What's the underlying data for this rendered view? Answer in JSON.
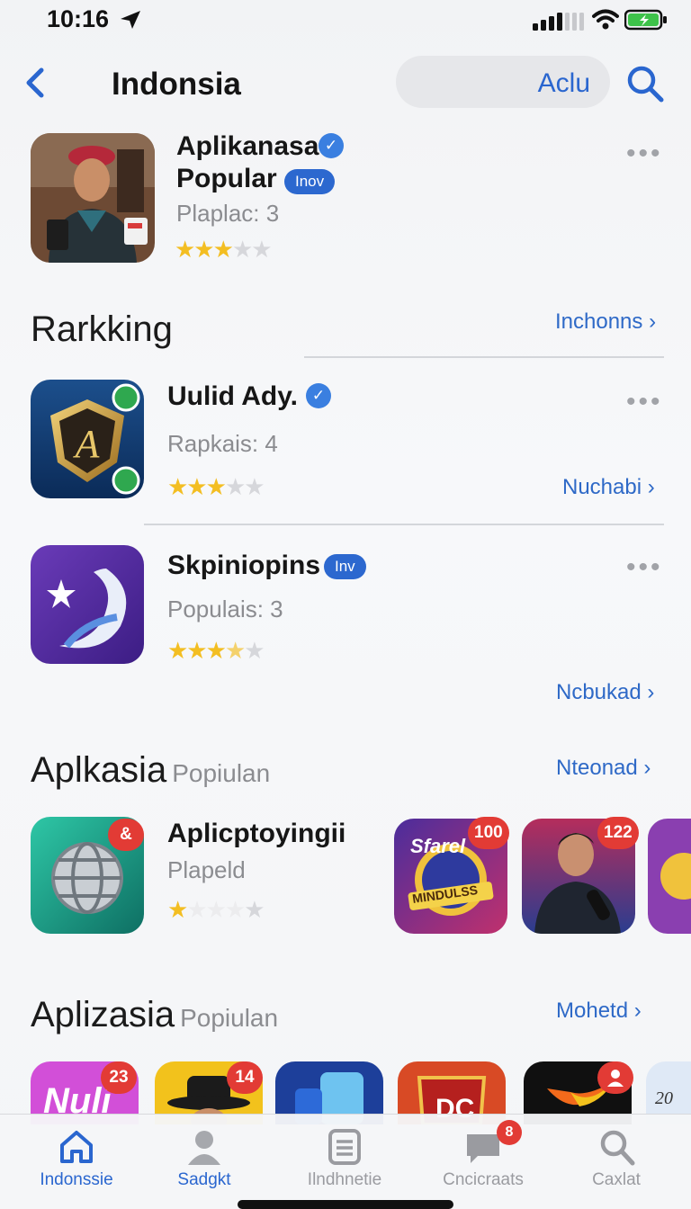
{
  "status_bar": {
    "time": "10:16"
  },
  "nav": {
    "title": "Indonsia",
    "pill_label": "Aclu"
  },
  "featured": {
    "name_line1": "Aplikanasa",
    "name_line2": "Popular",
    "tag": "Inov",
    "subtitle": "Plaplac: 3",
    "rating": 3
  },
  "ranking": {
    "title": "Rarkking",
    "see_all": "Inchonns",
    "items": [
      {
        "name": "Uulid Ady.",
        "subtitle": "Rapkais: 4",
        "rating": 3,
        "link": "Nuchabi"
      },
      {
        "name": "Skpiniopins",
        "tag": "Inv",
        "subtitle": "Populais: 3",
        "rating": 3.5,
        "link": "Ncbukad"
      }
    ]
  },
  "section_popular": {
    "title": "Aplkasia",
    "subtitle": "Popiulan",
    "see_all": "Nteonad",
    "app": {
      "name": "Aplicptoyingii",
      "subtitle": "Plapeld",
      "rating": 1,
      "badge": "&"
    },
    "tiles": [
      {
        "badge": "100",
        "art_line1": "Sfarel",
        "art_line2": "MINDULSS"
      },
      {
        "badge": "122"
      }
    ]
  },
  "section_popular2": {
    "title": "Aplizasia",
    "subtitle": "Popiulan",
    "see_all": "Mohetd",
    "tiles": [
      {
        "badge": "23",
        "art_text": "Nuli"
      },
      {
        "badge": "14"
      },
      {
        "badge": ""
      },
      {
        "badge": "",
        "art_text": "DC"
      },
      {
        "badge": ""
      },
      {
        "art_text": "20"
      }
    ]
  },
  "tab_bar": {
    "tabs": [
      {
        "label": "Indonssie",
        "icon": "home-icon"
      },
      {
        "label": "Sadgkt",
        "icon": "person-icon"
      },
      {
        "label": "Ilndhnetie",
        "icon": "list-icon"
      },
      {
        "label": "Cncicraats",
        "icon": "chat-icon",
        "badge": "8"
      },
      {
        "label": "Caxlat",
        "icon": "search-icon"
      }
    ]
  },
  "colors": {
    "accent": "#2a66cf",
    "star": "#f3be22",
    "badge": "#e23b35"
  }
}
